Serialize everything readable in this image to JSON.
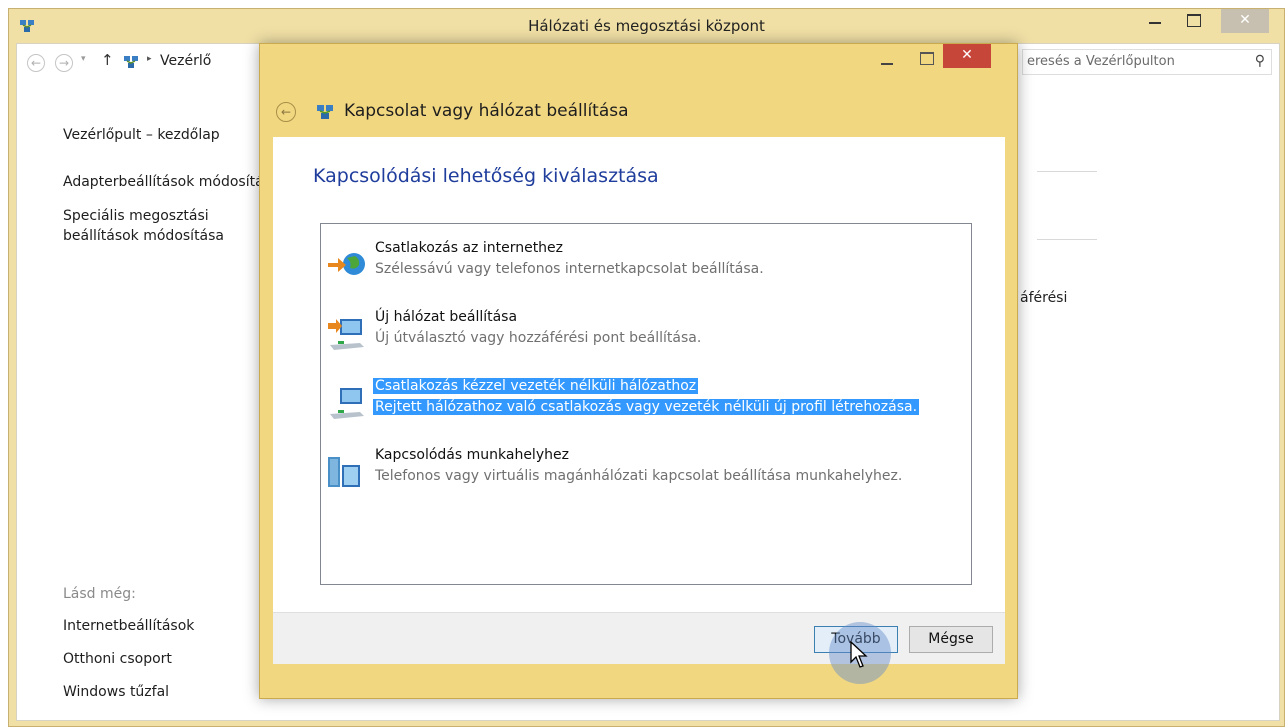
{
  "main_window": {
    "title": "Hálózati és megosztási központ",
    "close_symbol": "✕",
    "address": {
      "back_icon": "←",
      "forward_icon": "→",
      "dropdown_icon": "▾",
      "up_icon": "↑",
      "separator": "▸",
      "path_text": "Vezérlő"
    },
    "search": {
      "placeholder": "eresés a Vezérlőpulton",
      "icon_glyph": "⚲"
    },
    "sidebar": {
      "home_link": "Vezérlőpult – kezdőlap",
      "adapter_link": "Adapterbeállítások módosítá",
      "sharing_link_line1": "Speciális megosztási",
      "sharing_link_line2": "beállítások módosítása",
      "see_also_label": "Lásd még:",
      "see_also": [
        "Internetbeállítások",
        "Otthoni csoport",
        "Windows tűzfal"
      ]
    },
    "background_fragment": "áférési"
  },
  "dialog": {
    "close_symbol": "✕",
    "back_icon": "←",
    "title": "Kapcsolat vagy hálózat beállítása",
    "heading": "Kapcsolódási lehetőség kiválasztása",
    "options": [
      {
        "title": "Csatlakozás az internethez",
        "description": "Szélessávú vagy telefonos internetkapcsolat beállítása.",
        "icon": "globe-connect-icon",
        "selected": false
      },
      {
        "title": "Új hálózat beállítása",
        "description": "Új útválasztó vagy hozzáférési pont beállítása.",
        "icon": "router-setup-icon",
        "selected": false
      },
      {
        "title": "Csatlakozás kézzel vezeték nélküli hálózathoz",
        "description": "Rejtett hálózathoz való csatlakozás vagy vezeték nélküli új profil létrehozása.",
        "icon": "wireless-manual-icon",
        "selected": true
      },
      {
        "title": "Kapcsolódás munkahelyhez",
        "description": "Telefonos vagy virtuális magánhálózati kapcsolat beállítása munkahelyhez.",
        "icon": "workplace-vpn-icon",
        "selected": false
      }
    ],
    "buttons": {
      "next": "Tovább",
      "cancel": "Mégse"
    }
  },
  "colors": {
    "frame_active": "#f2d781",
    "frame_inactive": "#f0e0a6",
    "heading_blue": "#1f3d9c",
    "selection": "#3399ff",
    "close_red": "#c7463a"
  }
}
